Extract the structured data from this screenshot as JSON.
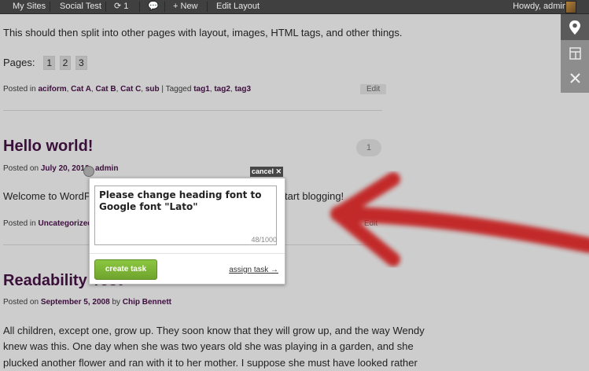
{
  "adminbar": {
    "my_sites": "My Sites",
    "site_name": "Social Test",
    "updates_count": "1",
    "new_label": "New",
    "edit_layout": "Edit Layout",
    "howdy": "Howdy, admin"
  },
  "posts": {
    "intro_text": "This should then split into other pages with layout, images, HTML tags, and other things.",
    "pages_label": "Pages:",
    "pages": [
      "1",
      "2",
      "3"
    ],
    "post1_meta": {
      "posted_in": "Posted in",
      "categories": [
        "aciform",
        "Cat A",
        "Cat B",
        "Cat C",
        "sub"
      ],
      "tagged": "| Tagged",
      "tags": [
        "tag1",
        "tag2",
        "tag3"
      ],
      "edit": "Edit"
    },
    "post2": {
      "title": "Hello world!",
      "posted_on": "Posted on",
      "date": "July 20, 2012",
      "author": "admin",
      "comments": "1",
      "body_left": "Welcome to WordPre",
      "body_right": "tart blogging!",
      "posted_in": "Posted in",
      "category": "Uncategorized",
      "edit": "Edit"
    },
    "post3": {
      "title": "Readability Test",
      "posted_on": "Posted on",
      "date": "September 5, 2008",
      "by": "by",
      "author": "Chip Bennett",
      "body_lines": [
        "All children, except one, grow up. They soon know that they will grow up, and the way Wendy",
        "knew was this. One day when she was two years old she was playing in a garden, and she",
        "plucked another flower and ran with it to her mother. I suppose she must have looked rather"
      ]
    }
  },
  "task_popup": {
    "cancel": "cancel ✕",
    "text": "Please change heading font to Google font \"Lato\"",
    "counter": "48/1000",
    "create_button": "create task",
    "assign_link": "assign task →"
  },
  "colors": {
    "admin_bar": "#404040",
    "heading": "#3a0f3a",
    "create_button": "#7cb536",
    "arrow": "#c21a1a"
  }
}
